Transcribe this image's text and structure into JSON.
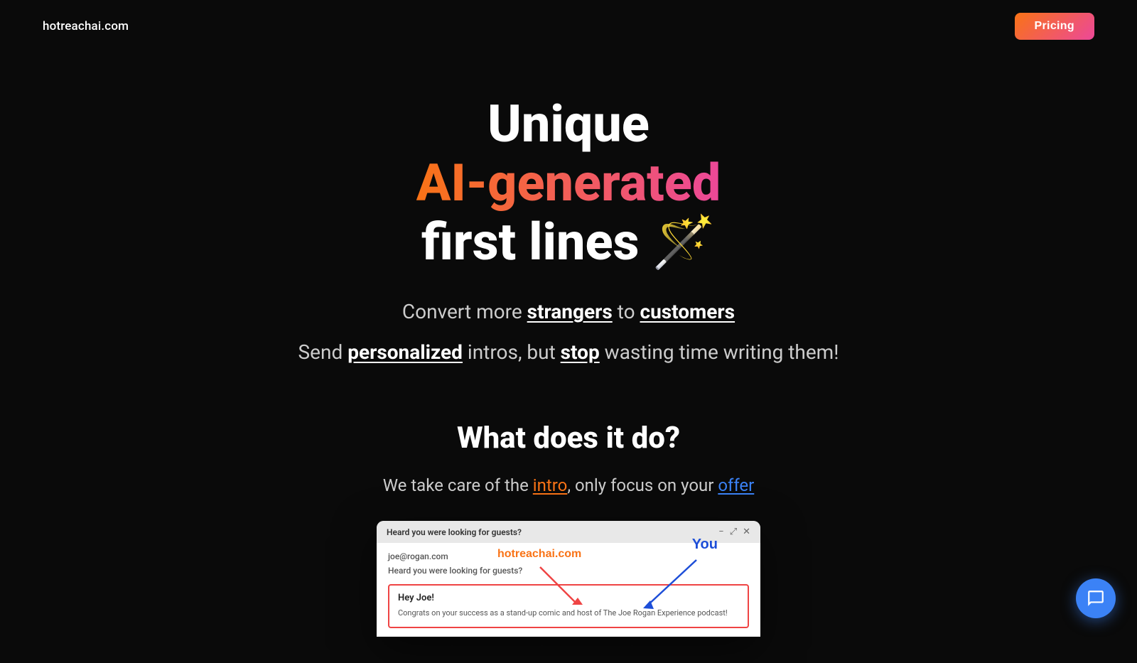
{
  "nav": {
    "logo": "hotreachai.com",
    "pricing_label": "Pricing"
  },
  "hero": {
    "line1": "Unique",
    "line2": "AI-generated",
    "line3": "first lines 🪄",
    "subtitle1_prefix": "Convert more ",
    "subtitle1_strangers": "strangers",
    "subtitle1_middle": " to ",
    "subtitle1_customers": "customers",
    "subtitle2_prefix": "Send ",
    "subtitle2_personalized": "personalized",
    "subtitle2_middle": " intros, but ",
    "subtitle2_stop": "stop",
    "subtitle2_suffix": " wasting time writing them!"
  },
  "section": {
    "title": "What does it do?",
    "desc_prefix": "We take care of the ",
    "desc_intro": "intro",
    "desc_middle": ", only focus on your ",
    "desc_offer": "offer"
  },
  "email": {
    "subject": "Heard you were looking for guests?",
    "from": "joe@rogan.com",
    "subject_line": "Heard you were looking for guests?",
    "greeting": "Hey Joe!",
    "body": "Congrats on your success as a stand-up comic and host of The Joe Rogan Experience podcast!",
    "controls": [
      "−",
      "⤢",
      "✕"
    ],
    "annotation_hotreachai": "hotreachai.com",
    "annotation_you": "You"
  },
  "chat": {
    "icon": "chat-icon"
  }
}
